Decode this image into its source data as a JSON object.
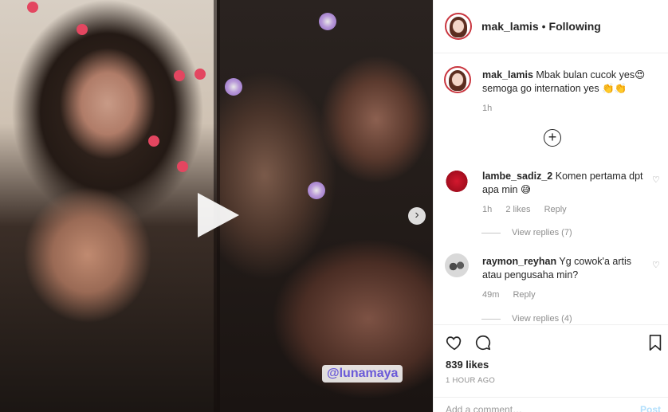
{
  "media": {
    "sticker_text": "@lunamaya"
  },
  "header": {
    "username": "mak_lamis",
    "separator": "•",
    "follow_status": "Following"
  },
  "caption": {
    "username": "mak_lamis",
    "text": "Mbak bulan cucok yes😍 semoga go internation yes 👏👏",
    "time": "1h"
  },
  "comments": [
    {
      "username": "lambe_sadiz_2",
      "text": "Komen pertama dpt apa min 😅",
      "time": "1h",
      "likes": "2 likes",
      "reply": "Reply",
      "view_replies": "View replies (7)"
    },
    {
      "username": "raymon_reyhan",
      "text": "Yg cowok'a artis atau pengusaha min?",
      "time": "49m",
      "reply": "Reply",
      "view_replies": "View replies (4)"
    }
  ],
  "actions": {
    "likes_count": "839 likes",
    "timestamp": "1 HOUR AGO",
    "add_comment_placeholder": "Add a comment…",
    "post_label": "Post"
  },
  "colors": {
    "avatar_ring": "#c9363f",
    "muted_text": "#8e8e8e",
    "post_button": "#b2dffc"
  }
}
